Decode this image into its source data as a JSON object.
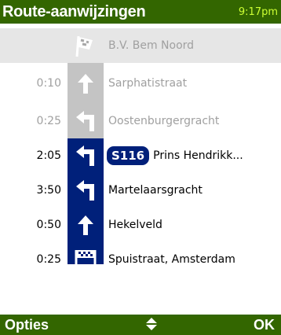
{
  "header": {
    "title": "Route-aanwijzingen",
    "clock": "9:17pm"
  },
  "steps": [
    {
      "time": "",
      "icon": "start-flag-icon",
      "road_badge": "",
      "street": "B.V. Bem Noord",
      "state": "past",
      "selected": true
    },
    {
      "time": "0:10",
      "icon": "arrow-straight-icon",
      "road_badge": "",
      "street": "Sarphatistraat",
      "state": "past",
      "selected": false
    },
    {
      "time": "0:25",
      "icon": "turn-left-icon",
      "road_badge": "",
      "street": "Oostenburgergracht",
      "state": "past",
      "selected": false
    },
    {
      "time": "2:05",
      "icon": "turn-left-icon",
      "road_badge": "S116",
      "street": "Prins Hendrikk...",
      "state": "future",
      "selected": false
    },
    {
      "time": "3:50",
      "icon": "turn-left-icon",
      "road_badge": "",
      "street": "Martelaarsgracht",
      "state": "future",
      "selected": false
    },
    {
      "time": "0:50",
      "icon": "arrow-straight-icon",
      "road_badge": "",
      "street": "Hekelveld",
      "state": "future",
      "selected": false
    },
    {
      "time": "0:25",
      "icon": "finish-flag-icon",
      "road_badge": "",
      "street": "Spuistraat, Amsterdam",
      "state": "future",
      "selected": false
    }
  ],
  "softkeys": {
    "left": "Opties",
    "center_icon": "up-down-arrows-icon",
    "right": "OK"
  },
  "colors": {
    "header_bg": "#336600",
    "clock": "#ccff33",
    "route_done": "#c4c4c4",
    "route_ahead": "#00207a"
  }
}
